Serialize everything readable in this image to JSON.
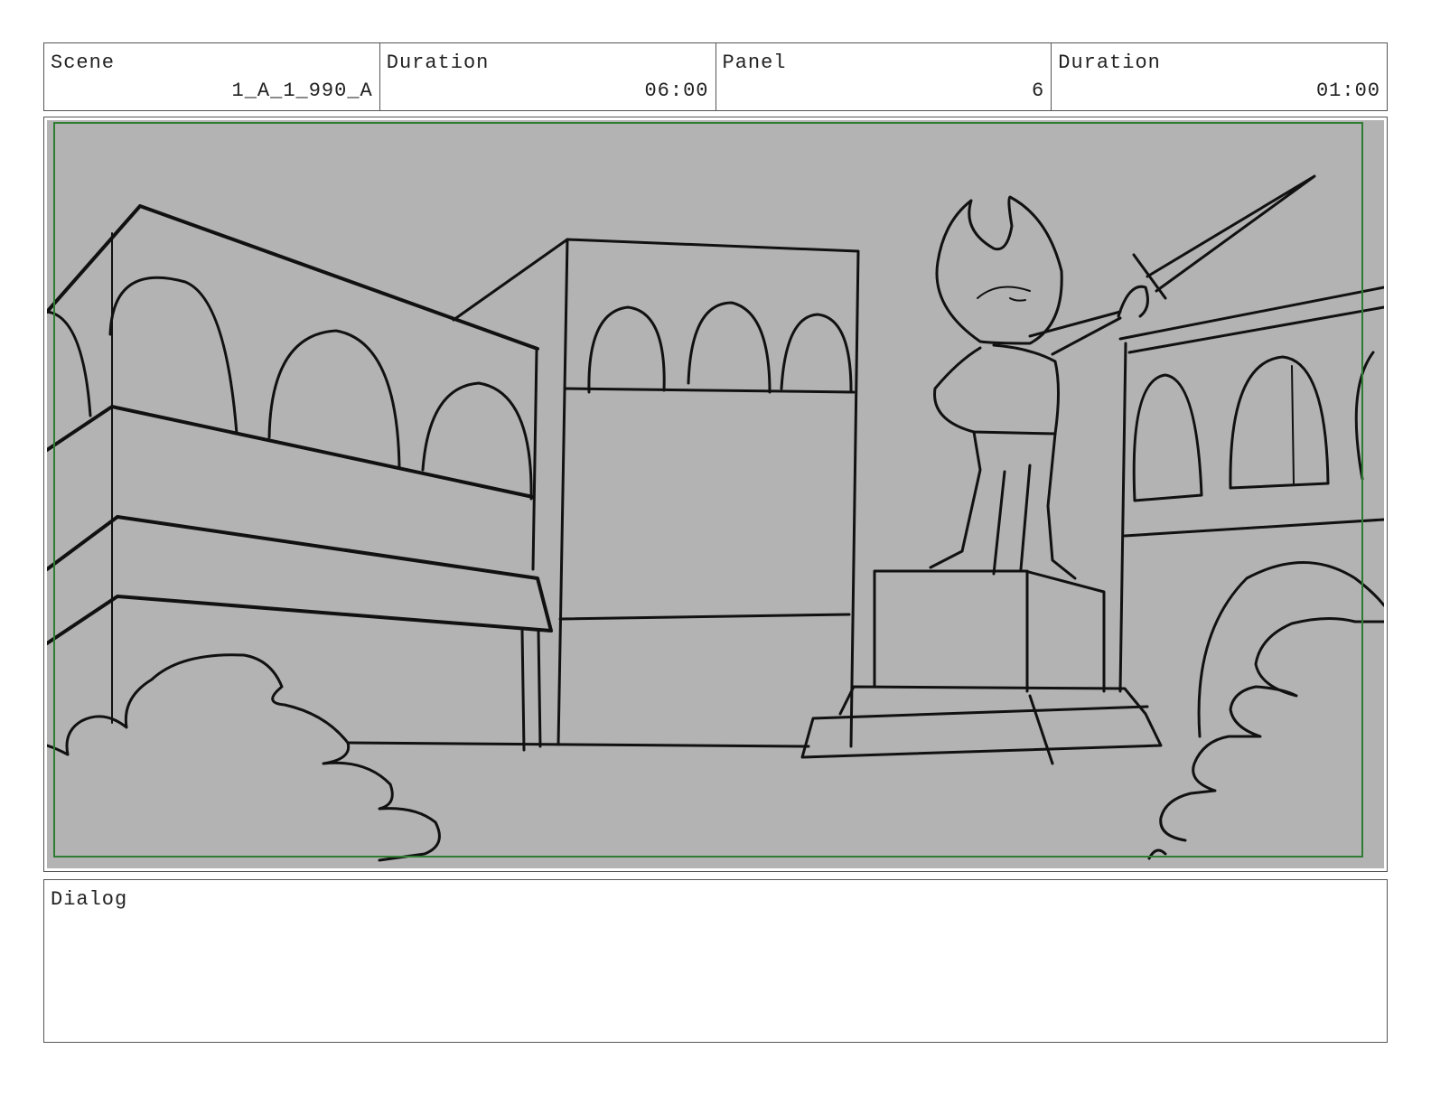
{
  "header": {
    "cells": [
      {
        "label": "Scene",
        "value": "1_A_1_990_A"
      },
      {
        "label": "Duration",
        "value": "06:00"
      },
      {
        "label": "Panel",
        "value": "6"
      },
      {
        "label": "Duration",
        "value": "01:00"
      }
    ]
  },
  "panel": {
    "background_color": "#b3b3b3",
    "safe_frame_color": "#2e7d32",
    "line_color": "#111111"
  },
  "dialog": {
    "label": "Dialog",
    "text": ""
  }
}
